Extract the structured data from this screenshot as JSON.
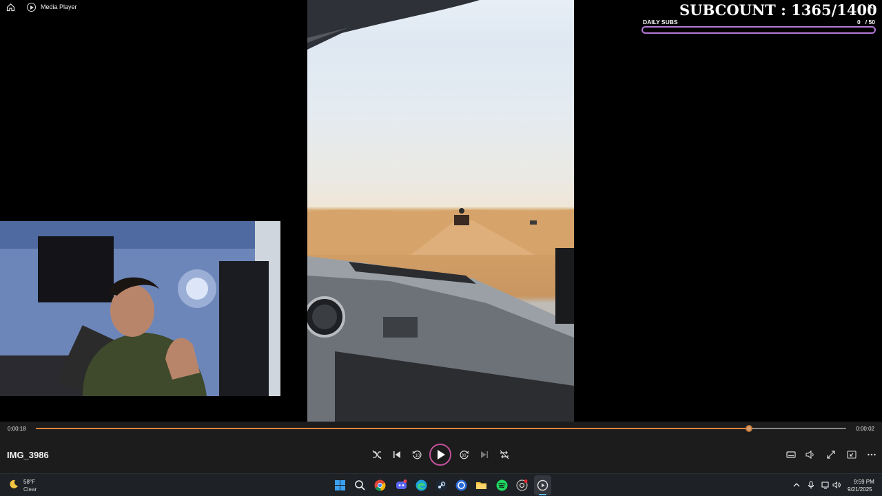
{
  "window": {
    "title": "Media Player"
  },
  "overlay": {
    "subcount_text": "SUBCOUNT : 1365/1400",
    "daily_label": "DAILY SUBS",
    "daily_count": "0   / 50",
    "daily_progress": 0,
    "accent_color": "#b47ad8"
  },
  "player": {
    "elapsed": "0:00:18",
    "remaining": "0:00:02",
    "progress": 0.88,
    "filename": "IMG_3986",
    "progress_color": "#e2873a",
    "play_ring_color": "#c2519b",
    "rewind_seconds": "10",
    "forward_seconds": "30"
  },
  "taskbar": {
    "weather_temp": "58°F",
    "weather_condition": "Clear",
    "clock_time": "9:59 PM",
    "clock_date": "9/21/2025",
    "pinned_icons": [
      "start-icon",
      "search-icon",
      "chrome-icon",
      "discord-icon",
      "edge-icon",
      "steam-icon",
      "app-icon",
      "file-explorer-icon",
      "spotify-icon",
      "obs-icon",
      "media-player-icon"
    ]
  }
}
